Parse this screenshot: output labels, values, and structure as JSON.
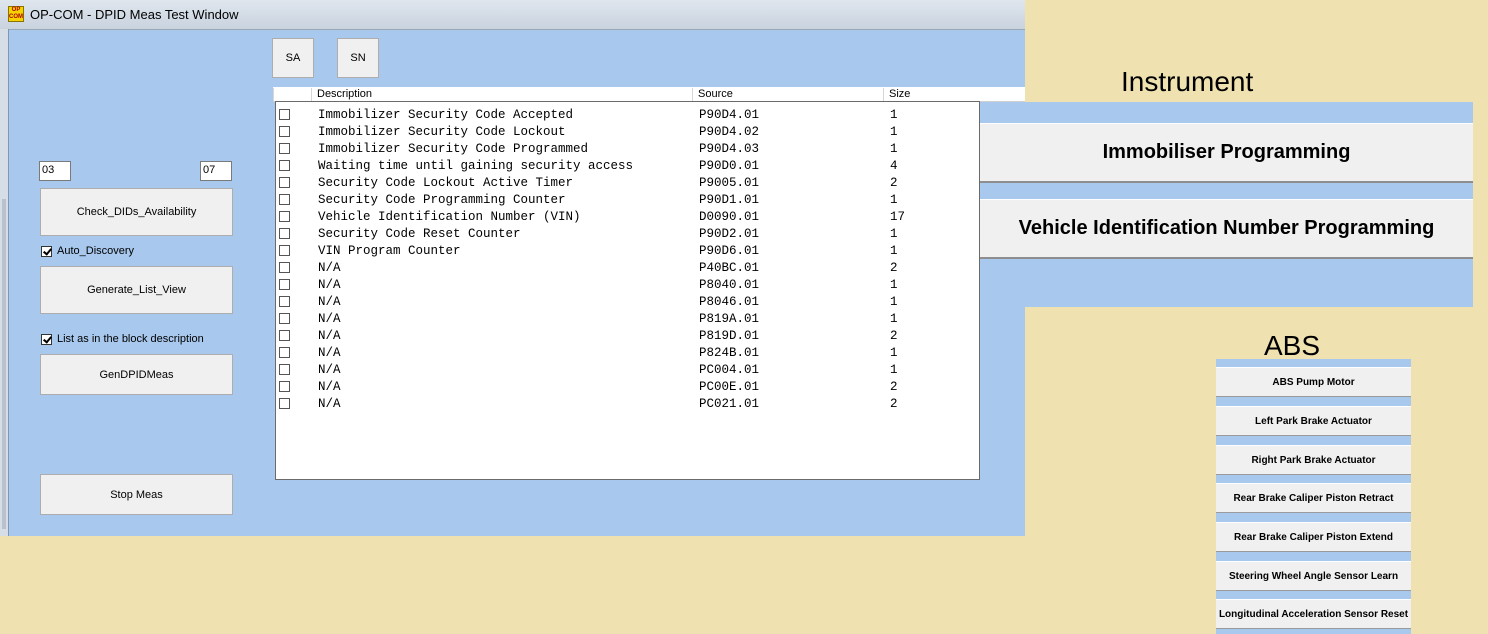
{
  "window": {
    "title": "OP-COM - DPID Meas Test Window",
    "icon_label": "OP COM"
  },
  "top_buttons": {
    "sa": "SA",
    "sn": "SN"
  },
  "left_panel": {
    "field_start": "03",
    "field_end": "07",
    "check_dids_label": "Check_DIDs_Availability",
    "auto_discovery_label": "Auto_Discovery",
    "auto_discovery_checked": true,
    "generate_list_label": "Generate_List_View",
    "list_as_block_label": "List as in the block description",
    "list_as_block_checked": true,
    "gen_dpid_label": "GenDPIDMeas",
    "stop_meas_label": "Stop Meas"
  },
  "list": {
    "columns": [
      "Description",
      "Source",
      "Size"
    ],
    "rows": [
      {
        "desc": "Immobilizer Security Code Accepted",
        "source": "P90D4.01",
        "size": "1"
      },
      {
        "desc": "Immobilizer Security Code Lockout",
        "source": "P90D4.02",
        "size": "1"
      },
      {
        "desc": "Immobilizer Security Code Programmed",
        "source": "P90D4.03",
        "size": "1"
      },
      {
        "desc": "Waiting time until gaining security access",
        "source": "P90D0.01",
        "size": "4"
      },
      {
        "desc": "Security Code Lockout Active Timer",
        "source": "P9005.01",
        "size": "2"
      },
      {
        "desc": "Security Code Programming Counter",
        "source": "P90D1.01",
        "size": "1"
      },
      {
        "desc": "Vehicle Identification Number (VIN)",
        "source": "D0090.01",
        "size": "17"
      },
      {
        "desc": "Security Code Reset Counter",
        "source": "P90D2.01",
        "size": "1"
      },
      {
        "desc": "VIN Program Counter",
        "source": "P90D6.01",
        "size": "1"
      },
      {
        "desc": "N/A",
        "source": "P40BC.01",
        "size": "2"
      },
      {
        "desc": "N/A",
        "source": "P8040.01",
        "size": "1"
      },
      {
        "desc": "N/A",
        "source": "P8046.01",
        "size": "1"
      },
      {
        "desc": "N/A",
        "source": "P819A.01",
        "size": "1"
      },
      {
        "desc": "N/A",
        "source": "P819D.01",
        "size": "2"
      },
      {
        "desc": "N/A",
        "source": "P824B.01",
        "size": "1"
      },
      {
        "desc": "N/A",
        "source": "PC004.01",
        "size": "1"
      },
      {
        "desc": "N/A",
        "source": "PC00E.01",
        "size": "2"
      },
      {
        "desc": "N/A",
        "source": "PC021.01",
        "size": "2"
      }
    ]
  },
  "instrument": {
    "heading": "Instrument",
    "buttons": [
      "Immobiliser Programming",
      "Vehicle Identification Number Programming"
    ]
  },
  "abs": {
    "heading": "ABS",
    "buttons": [
      "ABS Pump Motor",
      "Left Park Brake Actuator",
      "Right Park Brake Actuator",
      "Rear Brake Caliper Piston Retract",
      "Rear Brake Caliper Piston Extend",
      "Steering Wheel Angle Sensor Learn",
      "Longitudinal Acceleration Sensor Reset"
    ]
  },
  "colors": {
    "desktop_bg": "#efe2b0",
    "window_bg": "#a8c8ee",
    "button_bg": "#f0f0f0"
  }
}
